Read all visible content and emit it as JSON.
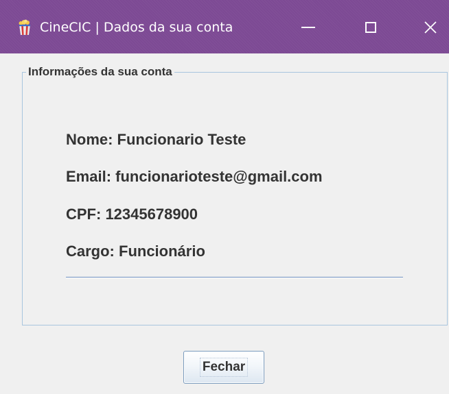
{
  "window": {
    "title": "CineCIC | Dados da sua conta",
    "icon": "cinema-popcorn-icon",
    "titlebar_color": "#7d4a94",
    "controls": {
      "minimize_icon": "minimize-icon",
      "maximize_icon": "maximize-icon",
      "close_icon": "close-icon"
    }
  },
  "account_info": {
    "group_title": "Informações da sua conta",
    "nome": "Nome: Funcionario Teste",
    "email": "Email: funcionarioteste@gmail.com",
    "cpf": "CPF: 12345678900",
    "cargo": "Cargo: Funcionário"
  },
  "actions": {
    "close_label": "Fechar"
  }
}
